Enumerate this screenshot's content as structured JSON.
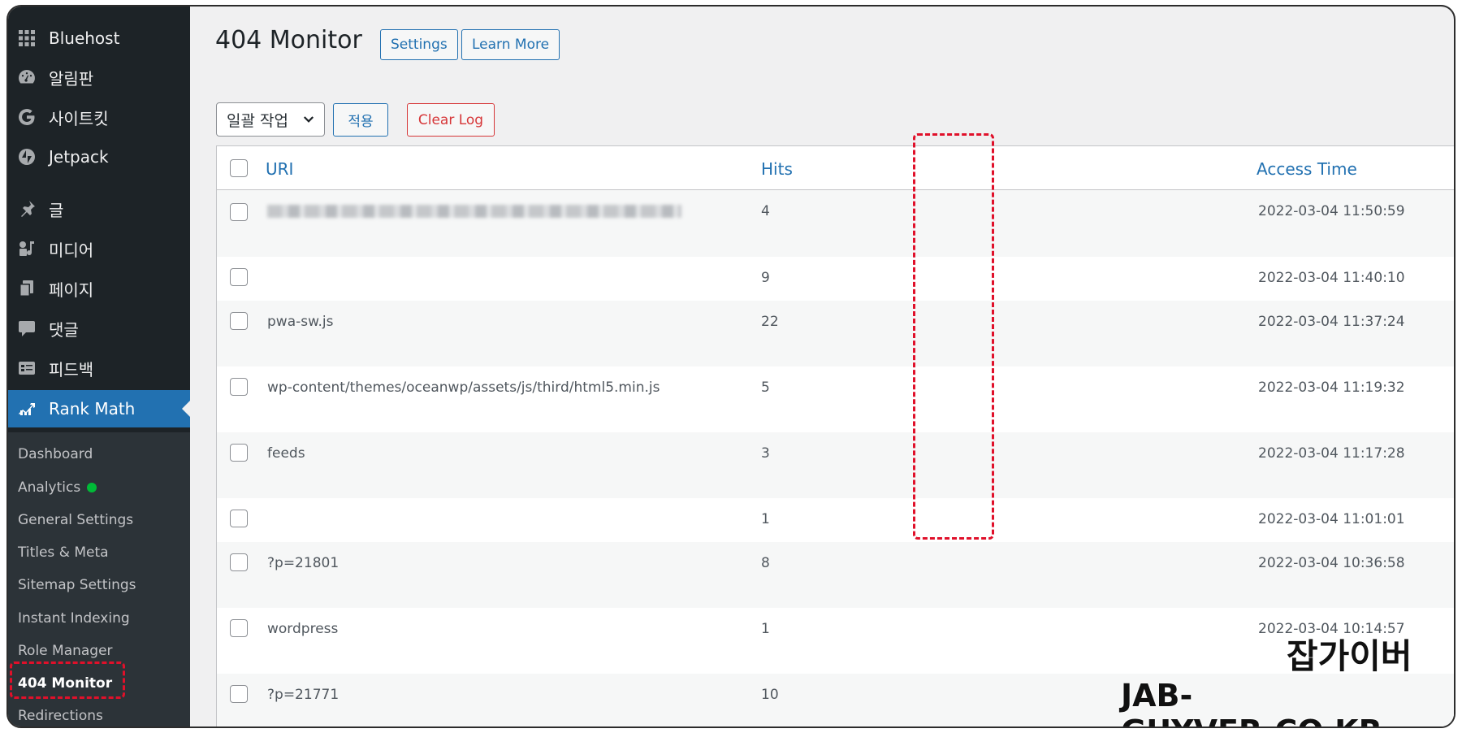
{
  "sidebar": {
    "items": [
      {
        "label": "Bluehost",
        "icon": "grid-icon"
      },
      {
        "label": "알림판",
        "icon": "dashboard-gauge-icon"
      },
      {
        "label": "사이트킷",
        "icon": "google-g-icon"
      },
      {
        "label": "Jetpack",
        "icon": "jetpack-icon"
      },
      {
        "label": "글",
        "icon": "pin-icon"
      },
      {
        "label": "미디어",
        "icon": "media-icon"
      },
      {
        "label": "페이지",
        "icon": "pages-icon"
      },
      {
        "label": "댓글",
        "icon": "comment-icon"
      },
      {
        "label": "피드백",
        "icon": "feedback-icon"
      },
      {
        "label": "Rank Math",
        "icon": "rank-math-icon"
      }
    ],
    "submenu": [
      {
        "label": "Dashboard"
      },
      {
        "label": "Analytics"
      },
      {
        "label": "General Settings"
      },
      {
        "label": "Titles & Meta"
      },
      {
        "label": "Sitemap Settings"
      },
      {
        "label": "Instant Indexing"
      },
      {
        "label": "Role Manager"
      },
      {
        "label": "404 Monitor"
      },
      {
        "label": "Redirections"
      }
    ]
  },
  "header": {
    "title": "404 Monitor",
    "settings_label": "Settings",
    "learn_more_label": "Learn More"
  },
  "toolbar": {
    "bulk_action_selected": "일괄 작업",
    "apply_label": "적용",
    "clear_log_label": "Clear Log"
  },
  "table": {
    "columns": {
      "uri": "URI",
      "hits": "Hits",
      "access_time": "Access Time"
    },
    "rows": [
      {
        "uri": "",
        "hits": "4",
        "time": "2022-03-04 11:50:59"
      },
      {
        "uri": "",
        "hits": "9",
        "time": "2022-03-04 11:40:10"
      },
      {
        "uri": "pwa-sw.js",
        "hits": "22",
        "time": "2022-03-04 11:37:24"
      },
      {
        "uri": "wp-content/themes/oceanwp/assets/js/third/html5.min.js",
        "hits": "5",
        "time": "2022-03-04 11:19:32"
      },
      {
        "uri": "feeds",
        "hits": "3",
        "time": "2022-03-04 11:17:28"
      },
      {
        "uri": "",
        "hits": "1",
        "time": "2022-03-04 11:01:01"
      },
      {
        "uri": "?p=21801",
        "hits": "8",
        "time": "2022-03-04 10:36:58"
      },
      {
        "uri": "wordpress",
        "hits": "1",
        "time": "2022-03-04 10:14:57"
      },
      {
        "uri": "?p=21771",
        "hits": "10",
        "time": ""
      }
    ]
  },
  "watermark": {
    "line1": "잡가이버",
    "line2": "JAB-GUYVER.CO.KR"
  },
  "colors": {
    "sidebar_bg": "#1d2327",
    "active_blue": "#2271b1",
    "highlight_red": "#e0102a",
    "online_dot": "#00ba37"
  }
}
